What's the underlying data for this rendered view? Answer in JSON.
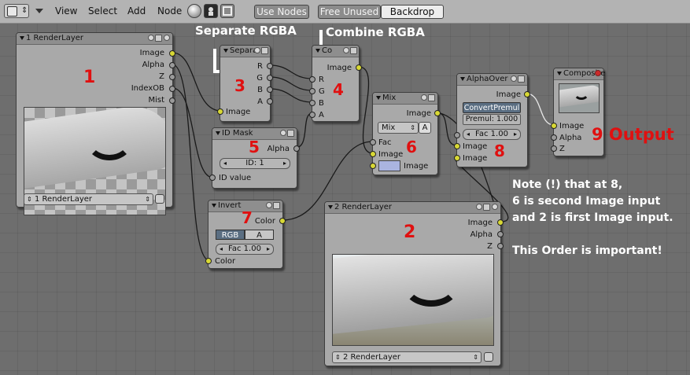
{
  "header": {
    "menus": [
      "View",
      "Select",
      "Add",
      "Node"
    ],
    "toggles": {
      "use_nodes": "Use Nodes",
      "free_unused": "Free Unused",
      "backdrop": "Backdrop"
    }
  },
  "nodes": {
    "render_layer_1": {
      "title": "1 RenderLayer",
      "outputs": [
        "Image",
        "Alpha",
        "Z",
        "IndexOB",
        "Mist"
      ],
      "layer_select": "1 RenderLayer"
    },
    "separate": {
      "title": "Separa",
      "outputs": [
        "R",
        "G",
        "B",
        "A"
      ],
      "input": "Image"
    },
    "combine": {
      "title": "Co",
      "output": "Image",
      "inputs": [
        "R",
        "G",
        "B",
        "A"
      ]
    },
    "id_mask": {
      "title": "ID Mask",
      "output": "Alpha",
      "field": "ID: 1",
      "input": "ID value"
    },
    "mix": {
      "title": "Mix",
      "output": "Image",
      "blend_mode": "Mix",
      "alpha_button": "A",
      "inputs": [
        "Fac",
        "Image",
        "Image"
      ]
    },
    "alpha_over": {
      "title": "AlphaOver",
      "output": "Image",
      "convert_button": "ConvertPremul",
      "premul": "Premul: 1.000",
      "fac": "Fac 1.00",
      "inputs": [
        "Image",
        "Image"
      ]
    },
    "composite": {
      "title": "Composite",
      "inputs": [
        "Image",
        "Alpha",
        "Z"
      ]
    },
    "invert": {
      "title": "Invert",
      "output": "Color",
      "rgb": "RGB",
      "a": "A",
      "fac": "Fac 1.00",
      "input": "Color"
    },
    "render_layer_2": {
      "title": "2 RenderLayer",
      "outputs": [
        "Image",
        "Alpha",
        "Z"
      ],
      "layer_select": "2 RenderLayer"
    }
  },
  "annotations": {
    "separate_label": "Separate RGBA",
    "combine_label": "Combine RGBA",
    "numbers": [
      "1",
      "2",
      "3",
      "4",
      "5",
      "6",
      "7",
      "8"
    ],
    "output_label": "9 Output",
    "note_lines": [
      "Note (!) that at 8,",
      "6 is second Image input",
      "and 2 is first Image input.",
      "",
      "This Order is important!"
    ]
  },
  "colors": {
    "annotation_red": "#e01010",
    "socket_yellow": "#d8d835",
    "socket_gray": "#9a9a9a"
  }
}
